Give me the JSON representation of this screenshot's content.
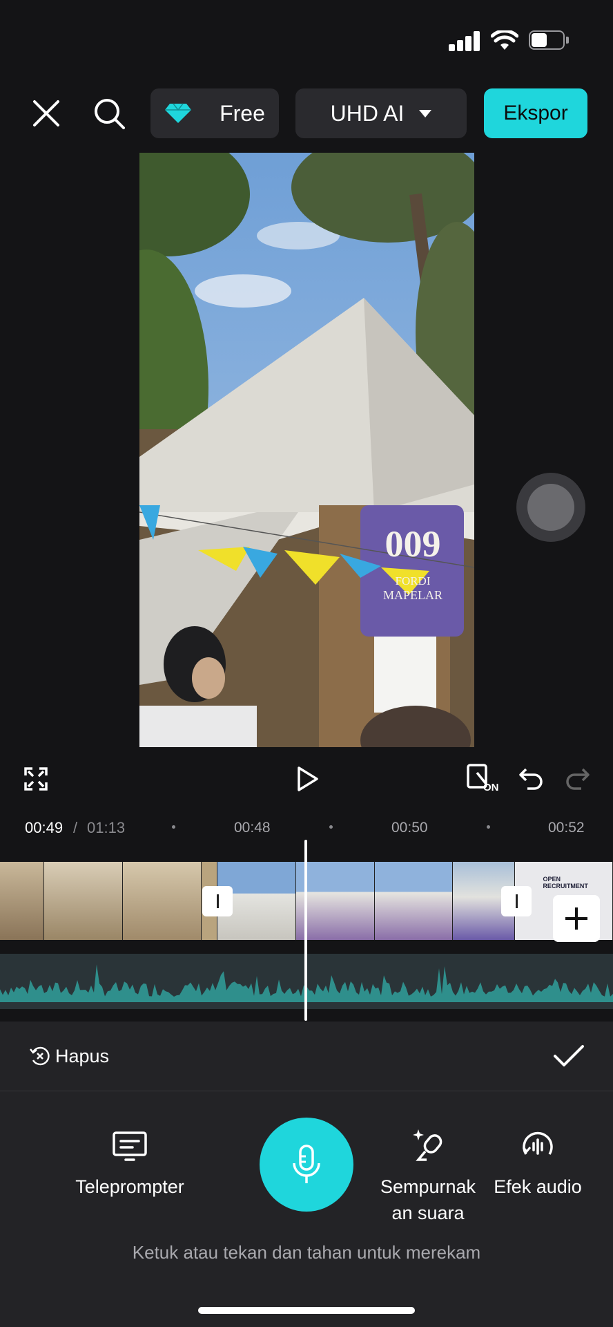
{
  "status_bar": {
    "signal": "signal-icon",
    "wifi": "wifi-icon",
    "battery": "battery-icon"
  },
  "toolbar": {
    "close_icon": "close-icon",
    "search_icon": "search-icon",
    "plan": {
      "icon": "diamond-icon",
      "label": "Free"
    },
    "quality": {
      "label": "UHD AI",
      "icon": "caret-down-icon"
    },
    "export_label": "Ekspor"
  },
  "preview": {
    "banner_number": "009",
    "banner_line1": "FORDI",
    "banner_line2": "MAPELAR"
  },
  "controls": {
    "fullscreen_icon": "fullscreen-icon",
    "play_icon": "play-icon",
    "keyframe_on_label": "ON",
    "undo_icon": "undo-icon",
    "redo_icon": "redo-icon"
  },
  "timeline": {
    "current_time": "00:49",
    "separator": "/",
    "total_time": "01:13",
    "ticks": [
      "00:48",
      "00:50",
      "00:52"
    ],
    "clip_sign_text": "OPEN RECRUITMENT",
    "add_icon": "plus-icon"
  },
  "bottom_panel": {
    "delete_label": "Hapus",
    "confirm_icon": "check-icon",
    "tools": [
      {
        "label": "Teleprompter",
        "icon": "teleprompter-icon"
      },
      {
        "label": "Sempurnak an suara",
        "line1": "Sempurnak",
        "line2": "an suara",
        "icon": "voice-enhance-icon"
      },
      {
        "label": "Efek audio",
        "icon": "audio-effect-icon"
      }
    ],
    "mic_icon": "microphone-icon",
    "hint": "Ketuk atau tekan dan tahan untuk merekam"
  },
  "colors": {
    "accent": "#1fd6dc",
    "background": "#141416",
    "panel": "#232326",
    "waveform": "#2f8f8c"
  }
}
